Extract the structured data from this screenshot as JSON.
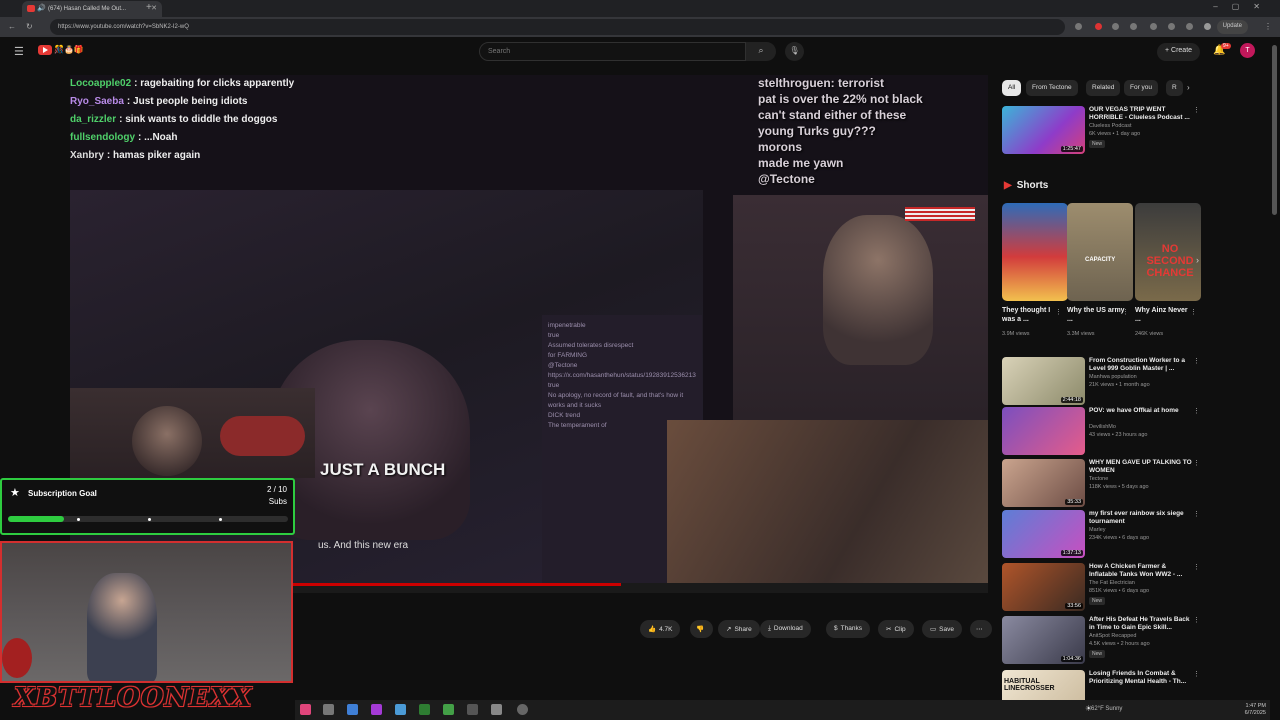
{
  "browser": {
    "tab_title": "(674) Hasan Called Me Out...",
    "url": "https://www.youtube.com/watch?v=SbNK2-I2-wQ",
    "update_label": "Update"
  },
  "youtube": {
    "search_placeholder": "Search",
    "create_label": "+ Create",
    "notifications": "9+",
    "avatar_letter": "T"
  },
  "video": {
    "overlay_chat": [
      {
        "user": "Locoapple02",
        "user_color": "#4fd06a",
        "text": ": ragebaiting for clicks apparently"
      },
      {
        "user": "Ryo_Saeba",
        "user_color": "#b98be8",
        "text": ": Just people being idiots"
      },
      {
        "user": "da_rizzler",
        "user_color": "#4fd06a",
        "text": ": sink wants to diddle the doggos"
      },
      {
        "user": "fullsendology",
        "user_color": "#4fd06a",
        "text": ": ...Noah"
      },
      {
        "user": "Xanbry",
        "user_color": "#dddddd",
        "text": ": hamas piker again"
      }
    ],
    "right_chat": [
      "stelthroguen: terrorist",
      "pat is over the 22% not black",
      "can't stand either of these",
      "young Turks guy???",
      "morons",
      "made me yawn",
      "@Tectone"
    ],
    "inner_chat": [
      "impenetrable",
      "true",
      "Assumed tolerates disrespect",
      "for FARMING",
      "@Tectone",
      "https://x.com/hasanthehun/status/19283912536213",
      "true",
      "No apology, no record of fault, and that's how it works and it sucks",
      "DICK trend",
      "The temperament of"
    ],
    "caption": "JUST A BUNCH",
    "subtitle": "us. And this new era"
  },
  "sub_goal": {
    "title": "Subscription Goal",
    "count": "2 / 10",
    "unit": "Subs",
    "progress": 0.2
  },
  "graffiti": "XBTTLOONEXX",
  "actions": [
    {
      "icon": "👍",
      "label": "4.7K"
    },
    {
      "icon": "👎",
      "label": ""
    },
    {
      "icon": "↗",
      "label": "Share"
    },
    {
      "icon": "⤓",
      "label": "Download"
    },
    {
      "icon": "$",
      "label": "Thanks"
    },
    {
      "icon": "✂",
      "label": "Clip"
    },
    {
      "icon": "▭",
      "label": "Save"
    },
    {
      "icon": "⋯",
      "label": ""
    }
  ],
  "chips": [
    "All",
    "From Tectone",
    "Related",
    "For you",
    "R"
  ],
  "top_rec": {
    "title": "OUR VEGAS TRIP WENT HORRIBLE - Clueless Podcast ...",
    "channel": "Clueless Podcast",
    "meta": "6K views • 1 day ago",
    "badge": "New",
    "duration": "1:25:47"
  },
  "shorts_header": "Shorts",
  "shorts": [
    {
      "title": "They thought I was a ...",
      "views": "3.9M views"
    },
    {
      "title": "Why the US army ...",
      "views": "3.3M views"
    },
    {
      "title": "Why Ainz Never ...",
      "views": "246K views"
    }
  ],
  "short_labels": [
    "",
    "CAPACITY",
    "NO SECOND CHANCE"
  ],
  "recs": [
    {
      "title": "From Construction Worker to a Level 999 Goblin Master | ...",
      "channel": "Manhwa population",
      "meta": "21K views • 1 month ago",
      "badge": "",
      "duration": "2:44:18"
    },
    {
      "title": "POV: we have Offkai at home",
      "channel": "DevilishMo",
      "meta": "43 views • 23 hours ago",
      "badge": "",
      "duration": ""
    },
    {
      "title": "WHY MEN GAVE UP TALKING TO WOMEN",
      "channel": "Tectone",
      "meta": "118K views • 5 days ago",
      "badge": "",
      "duration": "35:33"
    },
    {
      "title": "my first ever rainbow six siege tournament",
      "channel": "Marley",
      "meta": "234K views • 6 days ago",
      "badge": "",
      "duration": "1:37:13"
    },
    {
      "title": "How A Chicken Farmer & Inflatable Tanks Won WW2 - ...",
      "channel": "The Fat Electrician",
      "meta": "851K views • 6 days ago",
      "badge": "New",
      "duration": "33:56"
    },
    {
      "title": "After His Defeat He Travels Back in Time to Gain Epic Skill...",
      "channel": "AnitSpot Recapped",
      "meta": "4.5K views • 2 hours ago",
      "badge": "New",
      "duration": "1:04:36"
    },
    {
      "title": "Losing Friends In Combat & Prioritizing Mental Health - Th...",
      "channel": "",
      "meta": "",
      "badge": "",
      "duration": ""
    }
  ],
  "rec_banner_text": "HABITUAL LINECROSSER",
  "taskbar": {
    "weather": "62°F Sunny",
    "time": "1:47 PM",
    "date": "6/7/2025"
  },
  "colors": {
    "accent": "#cc0000",
    "goal_green": "#2ecc40"
  }
}
